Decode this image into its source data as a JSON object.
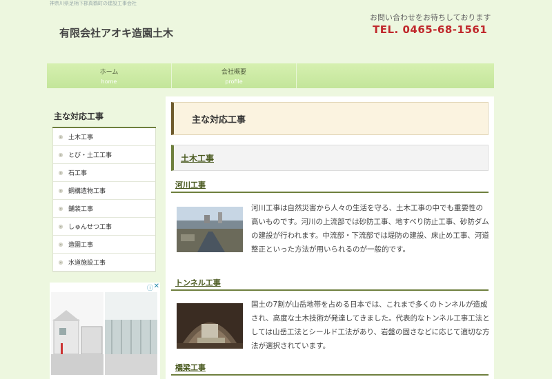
{
  "header": {
    "top_note": "神奈川県足柄下郡真鶴町の建設工事会社",
    "site_title": "有限会社アオキ造園土木",
    "contact_lead": "お問い合わせをお待ちしております",
    "tel": "TEL. 0465-68-1561"
  },
  "nav": {
    "items": [
      {
        "label": "ホーム",
        "sub": "home"
      },
      {
        "label": "会社概要",
        "sub": "profile"
      }
    ]
  },
  "sidebar": {
    "heading": "主な対応工事",
    "items": [
      {
        "label": "土木工事"
      },
      {
        "label": "とび・土工工事"
      },
      {
        "label": "石工事"
      },
      {
        "label": "鋼構造物工事"
      },
      {
        "label": "舗装工事"
      },
      {
        "label": "しゅんせつ工事"
      },
      {
        "label": "造園工事"
      },
      {
        "label": "水道施設工事"
      }
    ]
  },
  "main": {
    "page_heading": "主な対応工事",
    "section_heading": "土木工事",
    "subsections": [
      {
        "title": "河川工事",
        "text": "河川工事は自然災害から人々の生活を守る、土木工事の中でも重要性の高いものです。河川の上流部では砂防工事、地すべり防止工事、砂防ダムの建設が行われます。中流部・下流部では堤防の建設、床止め工事、河道整正といった方法が用いられるのが一般的です。",
        "image": "river-construction-photo"
      },
      {
        "title": "トンネル工事",
        "text": "国土の7割が山岳地帯を占める日本では、これまで多くのトンネルが造成され、高度な土木技術が発達してきました。代表的なトンネル工事工法としては山岳工法とシールド工法があり、岩盤の固さなどに応じて適切な方法が選択されています。",
        "image": "tunnel-construction-photo"
      },
      {
        "title": "橋梁工事"
      }
    ]
  },
  "ad": {
    "info_icon": "info-icon",
    "close_icon": "close-icon"
  },
  "colors": {
    "background": "#edf7df",
    "nav": "#c3e59a",
    "accent": "#6e7f3d",
    "tel": "#c0282c"
  }
}
